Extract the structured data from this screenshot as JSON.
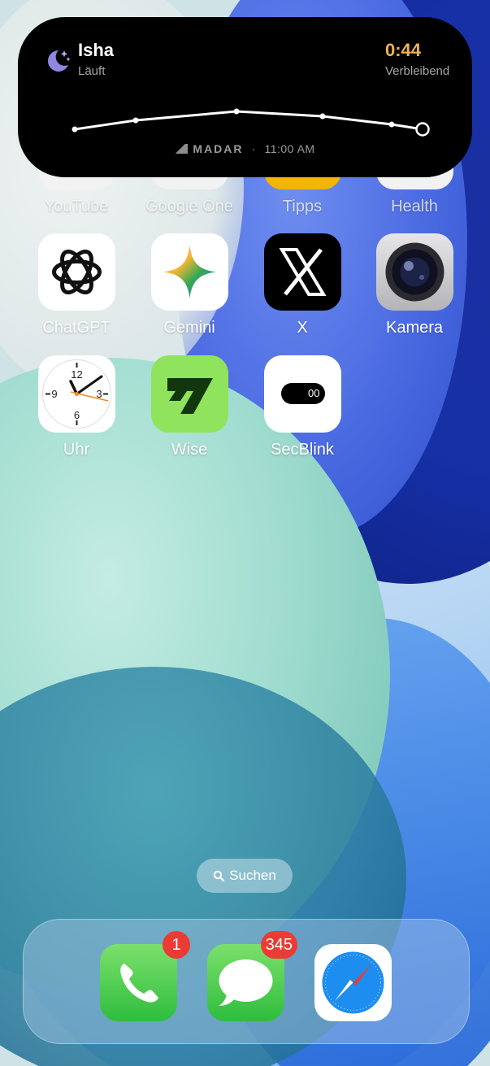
{
  "live_activity": {
    "title": "Isha",
    "status": "Läuft",
    "countdown": "0:44",
    "remaining_label": "Verbleibend",
    "brand": "MADAR",
    "separator": "·",
    "time": "11:00 AM",
    "accent_color": "#f0b452"
  },
  "apps": {
    "row0": [
      "YouTube",
      "Google One",
      "Tipps",
      "Health"
    ],
    "row1": [
      {
        "label": "ChatGPT",
        "icon": "chatgpt-icon"
      },
      {
        "label": "Gemini",
        "icon": "gemini-icon"
      },
      {
        "label": "X",
        "icon": "x-icon"
      },
      {
        "label": "Kamera",
        "icon": "camera-icon"
      }
    ],
    "row2": [
      {
        "label": "Uhr",
        "icon": "clock-icon"
      },
      {
        "label": "Wise",
        "icon": "wise-icon"
      },
      {
        "label": "SecBlink",
        "icon": "secblink-icon",
        "display": "00"
      }
    ]
  },
  "clock_face": {
    "n12": "12",
    "n3": "3",
    "n6": "6",
    "n9": "9"
  },
  "search": {
    "label": "Suchen"
  },
  "dock": {
    "phone_badge": "1",
    "messages_badge": "345"
  }
}
